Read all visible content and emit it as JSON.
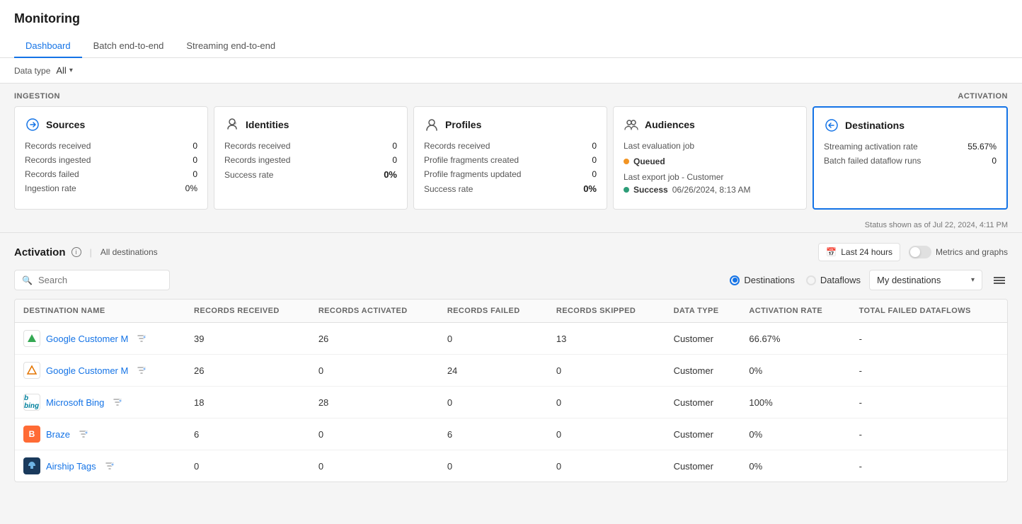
{
  "page": {
    "title": "Monitoring"
  },
  "tabs": [
    {
      "id": "dashboard",
      "label": "Dashboard",
      "active": true
    },
    {
      "id": "batch",
      "label": "Batch end-to-end",
      "active": false
    },
    {
      "id": "streaming",
      "label": "Streaming end-to-end",
      "active": false
    }
  ],
  "toolbar": {
    "data_type_label": "Data type",
    "data_type_value": "All"
  },
  "section_labels": {
    "ingestion": "INGESTION",
    "activation": "ACTIVATION"
  },
  "cards": {
    "sources": {
      "title": "Sources",
      "records_received_label": "Records received",
      "records_received_value": "0",
      "records_ingested_label": "Records ingested",
      "records_ingested_value": "0",
      "records_failed_label": "Records failed",
      "records_failed_value": "0",
      "ingestion_rate_label": "Ingestion rate",
      "ingestion_rate_value": "0%"
    },
    "identities": {
      "title": "Identities",
      "records_received_label": "Records received",
      "records_received_value": "0",
      "records_ingested_label": "Records ingested",
      "records_ingested_value": "0",
      "success_rate_label": "Success rate",
      "success_rate_value": "0%"
    },
    "profiles": {
      "title": "Profiles",
      "records_received_label": "Records received",
      "records_received_value": "0",
      "profile_fragments_created_label": "Profile fragments created",
      "profile_fragments_created_value": "0",
      "profile_fragments_updated_label": "Profile fragments updated",
      "profile_fragments_updated_value": "0",
      "success_rate_label": "Success rate",
      "success_rate_value": "0%"
    },
    "audiences": {
      "title": "Audiences",
      "last_evaluation_job_label": "Last evaluation job",
      "queued_label": "Queued",
      "last_export_job_label": "Last export job - Customer",
      "success_label": "Success",
      "success_time": "06/26/2024, 8:13 AM"
    },
    "destinations": {
      "title": "Destinations",
      "streaming_activation_rate_label": "Streaming activation rate",
      "streaming_activation_rate_value": "55.67%",
      "batch_failed_dataflow_runs_label": "Batch failed dataflow runs",
      "batch_failed_dataflow_runs_value": "0"
    }
  },
  "status_bar": {
    "text": "Status shown as of Jul 22, 2024, 4:11 PM"
  },
  "activation": {
    "title": "Activation",
    "all_destinations": "All destinations",
    "time_range": "Last 24 hours",
    "metrics_label": "Metrics and graphs",
    "search_placeholder": "Search",
    "radio_destinations": "Destinations",
    "radio_dataflows": "Dataflows",
    "destinations_dropdown": "My destinations",
    "table_headers": {
      "destination_name": "DESTINATION NAME",
      "records_received": "RECORDS RECEIVED",
      "records_activated": "RECORDS ACTIVATED",
      "records_failed": "RECORDS FAILED",
      "records_skipped": "RECORDS SKIPPED",
      "data_type": "DATA TYPE",
      "activation_rate": "ACTIVATION RATE",
      "total_failed_dataflows": "TOTAL FAILED DATAFLOWS"
    },
    "rows": [
      {
        "logo_type": "google-ads",
        "logo_text": "▶",
        "name": "Google Customer M",
        "records_received": "39",
        "records_activated": "26",
        "records_failed": "0",
        "records_skipped": "13",
        "data_type": "Customer",
        "activation_rate": "66.67%",
        "total_failed_dataflows": "-"
      },
      {
        "logo_type": "google-analytics",
        "logo_text": "▲",
        "name": "Google Customer M",
        "records_received": "26",
        "records_activated": "0",
        "records_failed": "24",
        "records_skipped": "0",
        "data_type": "Customer",
        "activation_rate": "0%",
        "total_failed_dataflows": "-"
      },
      {
        "logo_type": "bing",
        "logo_text": "b",
        "name": "Microsoft Bing",
        "records_received": "18",
        "records_activated": "28",
        "records_failed": "0",
        "records_skipped": "0",
        "data_type": "Customer",
        "activation_rate": "100%",
        "total_failed_dataflows": "-"
      },
      {
        "logo_type": "braze",
        "logo_text": "B",
        "name": "Braze",
        "records_received": "6",
        "records_activated": "0",
        "records_failed": "6",
        "records_skipped": "0",
        "data_type": "Customer",
        "activation_rate": "0%",
        "total_failed_dataflows": "-"
      },
      {
        "logo_type": "airship",
        "logo_text": "✈",
        "name": "Airship Tags",
        "records_received": "0",
        "records_activated": "0",
        "records_failed": "0",
        "records_skipped": "0",
        "data_type": "Customer",
        "activation_rate": "0%",
        "total_failed_dataflows": "-"
      }
    ]
  }
}
